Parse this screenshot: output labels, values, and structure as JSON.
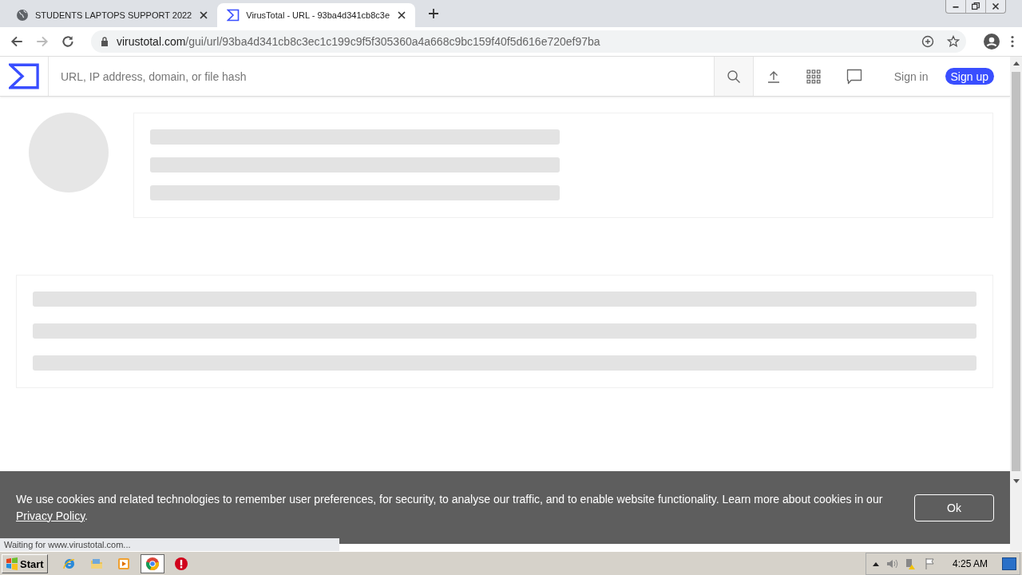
{
  "browser": {
    "tabs": [
      {
        "title": "STUDENTS LAPTOPS SUPPORT 2022",
        "selected": false
      },
      {
        "title": "VirusTotal - URL - 93ba4d341cb8c3e",
        "selected": true
      }
    ],
    "address": {
      "host": "virustotal.com",
      "path": "/gui/url/93ba4d341cb8c3ec1c199c9f5f305360a4a668c9bc159f40f5d616e720ef97ba"
    },
    "status_text": "Waiting for www.virustotal.com..."
  },
  "page": {
    "search": {
      "placeholder": "URL, IP address, domain, or file hash"
    },
    "sign_in": "Sign in",
    "sign_up": "Sign up",
    "cookie": {
      "text": "We use cookies and related technologies to remember user preferences, for security, to analyse our traffic, and to enable website functionality. Learn more about cookies in our ",
      "link": "Privacy Policy",
      "after": ".",
      "button": "Ok"
    }
  },
  "taskbar": {
    "start": "Start",
    "apps": [
      {
        "kind": "ie",
        "selected": false
      },
      {
        "kind": "folder",
        "selected": false
      },
      {
        "kind": "media",
        "selected": false
      },
      {
        "kind": "chrome",
        "selected": true
      },
      {
        "kind": "stop",
        "selected": false
      }
    ],
    "clock": "4:25 AM"
  }
}
